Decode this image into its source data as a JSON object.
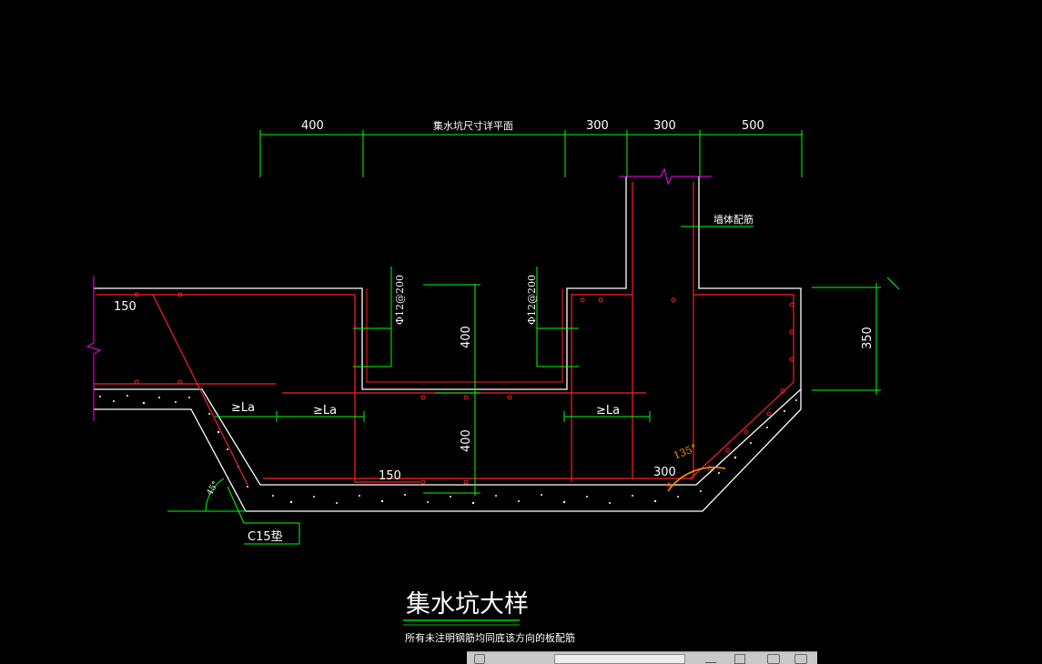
{
  "drawing": {
    "title": "集水坑大样",
    "subtitle": "所有未注明钢筋均同底该方向的板配筋",
    "plan_ref": "集水坑尺寸详平面",
    "top_dims": [
      "400",
      "300",
      "300",
      "500"
    ],
    "right_dim": "350",
    "inner_dims": [
      "400",
      "400"
    ],
    "rebar_labels": [
      "Φ12@200",
      "Φ12@200"
    ],
    "lap_labels": [
      "≥La",
      "≥La",
      "≥La"
    ],
    "cover_labels": [
      "150",
      "150",
      "300"
    ],
    "angle": "135°",
    "wall_note": "墙体配筋",
    "concrete": "C15垫",
    "slope": "45°"
  },
  "colors": {
    "background": "#000000",
    "outline": "#ffffff",
    "rebar": "#ff2020",
    "dimension": "#00ff00",
    "break_mark": "#ff00ff",
    "angle_arc": "#ff9900"
  }
}
